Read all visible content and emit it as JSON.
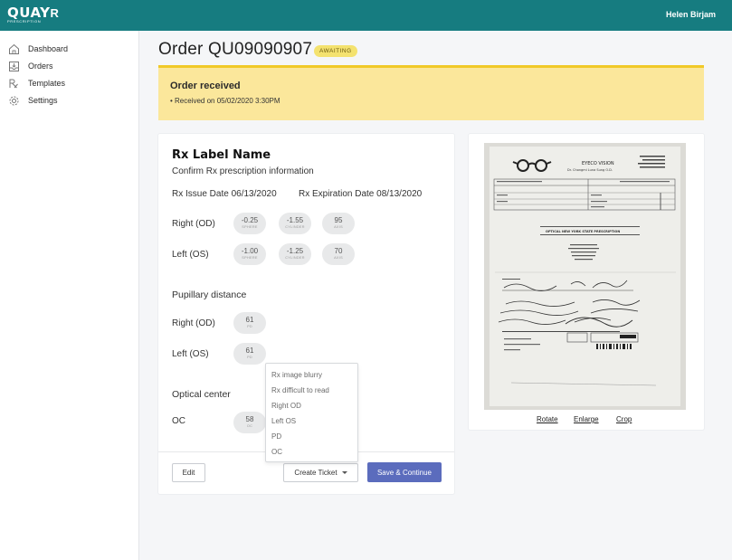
{
  "header": {
    "logo_text": "QUAY",
    "logo_r": "R",
    "logo_sub": "PRESCRIPTION",
    "user_name": "Helen Birjam"
  },
  "sidebar": {
    "items": [
      {
        "label": "Dashboard",
        "icon": "home-icon"
      },
      {
        "label": "Orders",
        "icon": "inbox-icon"
      },
      {
        "label": "Templates",
        "icon": "rx-template-icon"
      },
      {
        "label": "Settings",
        "icon": "gear-icon"
      }
    ]
  },
  "order": {
    "title": "Order QU09090907",
    "status": "AWAITING"
  },
  "banner": {
    "title": "Order received",
    "line": "Received on 05/02/2020 3:30PM"
  },
  "rx": {
    "title": "Rx Label Name",
    "subtitle": "Confirm Rx prescription information",
    "issue_date": "Rx Issue Date 06/13/2020",
    "expiration_date": "Rx Expiration Date 08/13/2020",
    "right_label": "Right (OD)",
    "left_label": "Left (OS)",
    "right": {
      "sphere": {
        "value": "-0.25",
        "label": "SPHERE"
      },
      "cylinder": {
        "value": "-1.55",
        "label": "CYLINDER"
      },
      "axis": {
        "value": "95",
        "label": "AXIS"
      }
    },
    "left": {
      "sphere": {
        "value": "-1.00",
        "label": "SPHERE"
      },
      "cylinder": {
        "value": "-1.25",
        "label": "CYLINDER"
      },
      "axis": {
        "value": "70",
        "label": "AXIS"
      }
    }
  },
  "pd": {
    "title": "Pupillary distance",
    "right_label": "Right (OD)",
    "left_label": "Left (OS)",
    "right": {
      "value": "61",
      "label": "PD"
    },
    "left": {
      "value": "61",
      "label": "PD"
    }
  },
  "oc": {
    "title": "Optical center",
    "label": "OC",
    "value": {
      "value": "58",
      "label": "OC"
    }
  },
  "actions": {
    "edit": "Edit",
    "create_ticket": "Create Ticket",
    "save_continue": "Save & Continue"
  },
  "ticket_menu": [
    "Rx image blurry",
    "Rx difficult to read",
    "Right OD",
    "Left OS",
    "PD",
    "OC"
  ],
  "document": {
    "clinic_name": "EYECO VISION",
    "doctor": "Dr. Chongmi Luna Sung O.D.",
    "form_title": "OPTICAL NEW YORK STATE PRESCRIPTION",
    "links": {
      "rotate": "Rotate",
      "enlarge": "Enlarge",
      "crop": "Crop"
    }
  },
  "colors": {
    "topbar": "#167c80",
    "banner": "#fbe79b",
    "banner_border": "#f1c928",
    "badge": "#f4e26f",
    "primary_button": "#5b6cbd"
  }
}
